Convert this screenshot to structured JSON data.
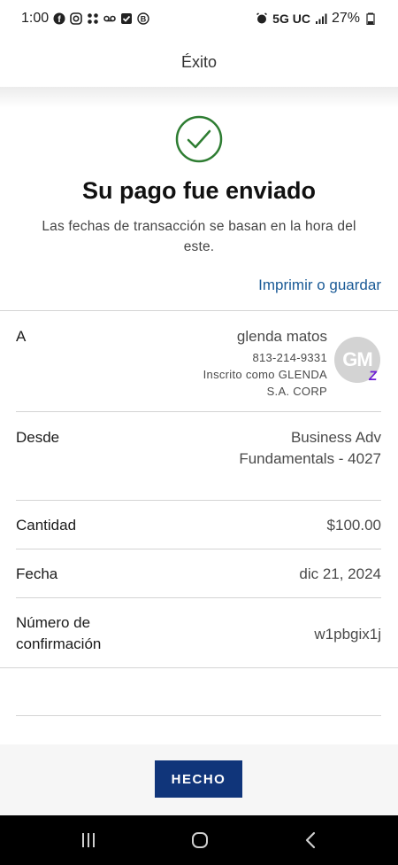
{
  "status_bar": {
    "time": "1:00",
    "network": "5G UC",
    "battery": "27%",
    "left_icons": [
      "facebook-icon",
      "instagram-icon",
      "apps-icon",
      "voicemail-icon",
      "checkbox-icon",
      "b-badge-icon"
    ],
    "right_icons": [
      "alarm-icon",
      "signal-icon",
      "battery-icon"
    ]
  },
  "header": {
    "title": "Éxito"
  },
  "success": {
    "title": "Su pago fue enviado",
    "subtitle": "Las fechas de transacción se basan en la hora del este.",
    "print_link": "Imprimir o guardar",
    "check_color": "#2e7d32"
  },
  "recipient": {
    "label": "A",
    "name": "glenda matos",
    "phone": "813-214-9331",
    "enrolled_line1": "Inscrito como GLENDA",
    "enrolled_line2": "S.A. CORP",
    "avatar_initials": "GM",
    "badge_glyph": "Z"
  },
  "from": {
    "label": "Desde",
    "value_line1": "Business Adv",
    "value_line2": "Fundamentals - 4027"
  },
  "amount": {
    "label": "Cantidad",
    "value": "$100.00"
  },
  "date": {
    "label": "Fecha",
    "value": "dic 21, 2024"
  },
  "confirmation": {
    "label_line1": "Número de",
    "label_line2": "confirmación",
    "value": "w1pbgix1j"
  },
  "actions": {
    "done_label": "HECHO",
    "done_color": "#10357a"
  },
  "nav": {
    "buttons": [
      "recents-icon",
      "home-icon",
      "back-icon"
    ]
  }
}
